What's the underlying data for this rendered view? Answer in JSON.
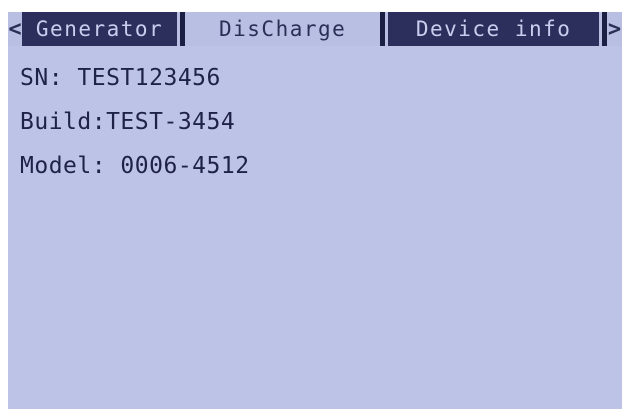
{
  "tabs": {
    "left_arrow": "<",
    "right_arrow": ">",
    "items": [
      {
        "label": "Generator",
        "active": false
      },
      {
        "label": "DisCharge",
        "active": false
      },
      {
        "label": "Device info",
        "active": true
      }
    ]
  },
  "device": {
    "sn": "SN: TEST123456",
    "build": "Build:TEST-3454",
    "model": "Model: 0006-4512"
  },
  "colors": {
    "background": "#bdc3e6",
    "text": "#1e2246",
    "active_tab": "#2c2f5c"
  }
}
